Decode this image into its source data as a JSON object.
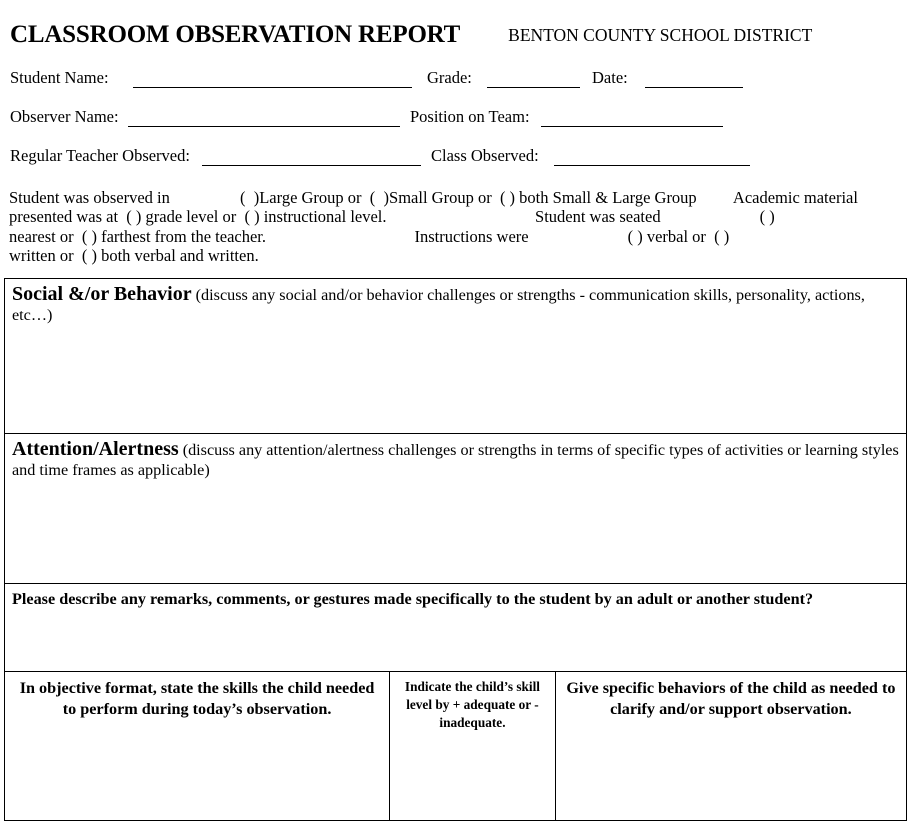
{
  "header": {
    "title": "CLASSROOM OBSERVATION REPORT",
    "district": "BENTON COUNTY SCHOOL DISTRICT"
  },
  "form": {
    "student_name_label": "Student Name:",
    "student_name_value": "",
    "grade_label": "Grade:",
    "grade_value": "",
    "date_label": "Date:",
    "date_value": "",
    "observer_name_label": "Observer Name:",
    "observer_name_value": "",
    "position_label": "Position on Team:",
    "position_value": "",
    "regular_teacher_label": "Regular Teacher Observed:",
    "regular_teacher_value": "",
    "class_observed_label": "Class Observed:",
    "class_observed_value": ""
  },
  "observation_paragraph": {
    "line1": "Student was observed in                 (  )Large Group or  (  )Small Group or  ( ) both Small & Large Group         Academic material",
    "line2": "presented was at  ( ) grade level or  ( ) instructional level.                                    Student was seated                        ( )",
    "line3": "nearest or  ( ) farthest from the teacher.                                    Instructions were                        ( ) verbal or  ( )",
    "line4": "written or  ( ) both verbal and written."
  },
  "sections": {
    "social": {
      "heading": "Social &/or Behavior",
      "prompt": " (discuss any social and/or behavior challenges or strengths - communication skills, personality, actions, etc…)",
      "response": ""
    },
    "attention": {
      "heading": "Attention/Alertness",
      "prompt": " (discuss any attention/alertness challenges or strengths in terms of specific types of activities or learning styles and time frames as applicable)",
      "response": ""
    },
    "remarks": {
      "prompt": "Please describe any remarks, comments, or gestures made specifically to the student by an adult or another student?",
      "response": ""
    }
  },
  "skills_table": {
    "columns": [
      {
        "header": "In objective format, state the skills the child needed to perform during today’s observation.",
        "cell": ""
      },
      {
        "header": "Indicate the child’s skill level by + adequate or - inadequate.",
        "cell": ""
      },
      {
        "header": "Give specific behaviors of the child as needed to clarify and/or support observation.",
        "cell": ""
      }
    ]
  },
  "colors": {
    "ink": "#000000",
    "paper": "#ffffff"
  }
}
